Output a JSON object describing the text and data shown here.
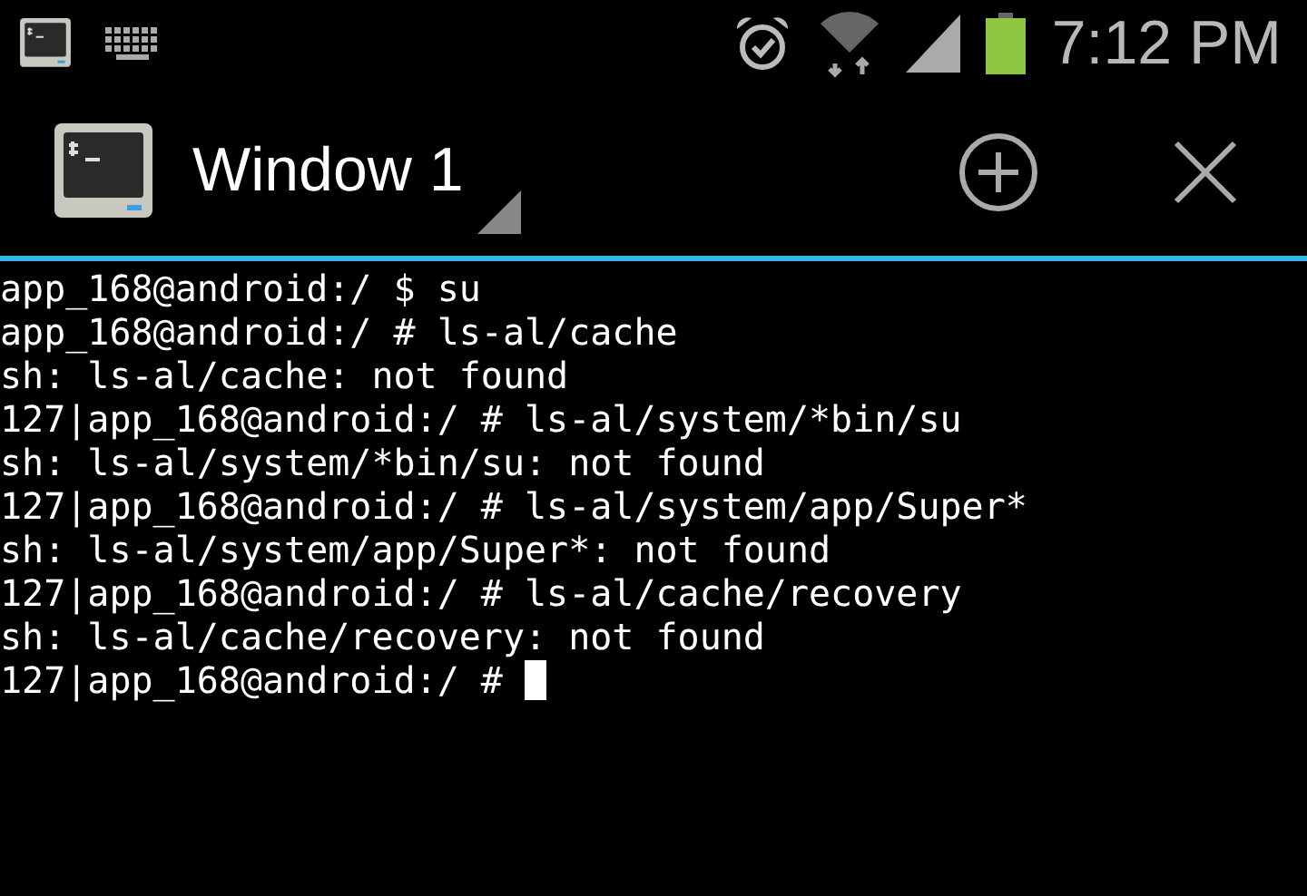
{
  "status_bar": {
    "time": "7:12 PM"
  },
  "action_bar": {
    "title": "Window 1"
  },
  "terminal": {
    "lines": [
      "app_168@android:/ $ su",
      "app_168@android:/ # ls-al/cache",
      "sh: ls-al/cache: not found",
      "127|app_168@android:/ # ls-al/system/*bin/su",
      "sh: ls-al/system/*bin/su: not found",
      "127|app_168@android:/ # ls-al/system/app/Super*",
      "sh: ls-al/system/app/Super*: not found",
      "127|app_168@android:/ # ls-al/cache/recovery",
      "sh: ls-al/cache/recovery: not found",
      "127|app_168@android:/ #"
    ],
    "cursor_visible": true
  }
}
